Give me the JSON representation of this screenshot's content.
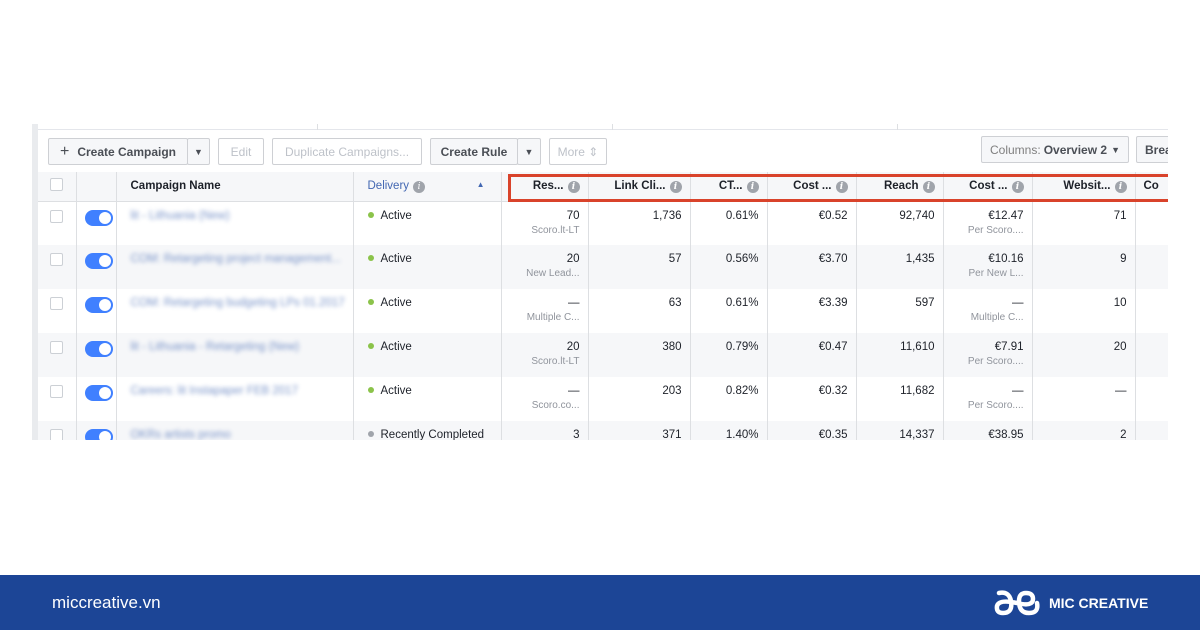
{
  "toolbar": {
    "create_campaign": "Create Campaign",
    "edit": "Edit",
    "duplicate": "Duplicate Campaigns...",
    "create_rule": "Create Rule",
    "more": "More ⇕",
    "columns_label": "Columns:",
    "columns_value": "Overview 2",
    "breakdown": "Brea"
  },
  "columns": [
    "Campaign Name",
    "Delivery",
    "Res...",
    "Link Cli...",
    "CT...",
    "Cost ...",
    "Reach",
    "Cost ...",
    "Websit...",
    "Co"
  ],
  "rows": [
    {
      "name": "lit - Lithuania (New)",
      "delivery": "Active",
      "status": "active",
      "results": "70",
      "results_sub": "Scoro.lt-LT",
      "link_clicks": "1,736",
      "ctr": "0.61%",
      "cpc": "€0.52",
      "reach": "92,740",
      "cost_per": "€12.47",
      "cost_per_sub": "Per Scoro....",
      "website": "71"
    },
    {
      "name": "COM: Retargeting project management...",
      "delivery": "Active",
      "status": "active",
      "results": "20",
      "results_sub": "New Lead...",
      "link_clicks": "57",
      "ctr": "0.56%",
      "cpc": "€3.70",
      "reach": "1,435",
      "cost_per": "€10.16",
      "cost_per_sub": "Per New L...",
      "website": "9"
    },
    {
      "name": "COM: Retargeting budgeting LPs 01.2017",
      "delivery": "Active",
      "status": "active",
      "results": "—",
      "results_sub": "Multiple C...",
      "link_clicks": "63",
      "ctr": "0.61%",
      "cpc": "€3.39",
      "reach": "597",
      "cost_per": "—",
      "cost_per_sub": "Multiple C...",
      "website": "10"
    },
    {
      "name": "lit - Lithuania - Retargeting (New)",
      "delivery": "Active",
      "status": "active",
      "results": "20",
      "results_sub": "Scoro.lt-LT",
      "link_clicks": "380",
      "ctr": "0.79%",
      "cpc": "€0.47",
      "reach": "11,610",
      "cost_per": "€7.91",
      "cost_per_sub": "Per Scoro....",
      "website": "20"
    },
    {
      "name": "Careers: lit Instapaper FEB 2017",
      "delivery": "Active",
      "status": "active",
      "results": "—",
      "results_sub": "Scoro.co...",
      "link_clicks": "203",
      "ctr": "0.82%",
      "cpc": "€0.32",
      "reach": "11,682",
      "cost_per": "—",
      "cost_per_sub": "Per Scoro....",
      "website": "—"
    },
    {
      "name": "OKRs artists promo",
      "delivery": "Recently Completed",
      "status": "completed",
      "results": "3",
      "results_sub": "",
      "link_clicks": "371",
      "ctr": "1.40%",
      "cpc": "€0.35",
      "reach": "14,337",
      "cost_per": "€38.95",
      "cost_per_sub": "",
      "website": "2"
    }
  ],
  "colors": {
    "active": "#8bc34a",
    "completed": "#a0a4ab",
    "highlight": "#d9432b",
    "footer": "#1c4596",
    "toggle": "#4080ff"
  },
  "footer": {
    "site": "miccreative.vn",
    "brand": "MIC CREATIVE"
  }
}
